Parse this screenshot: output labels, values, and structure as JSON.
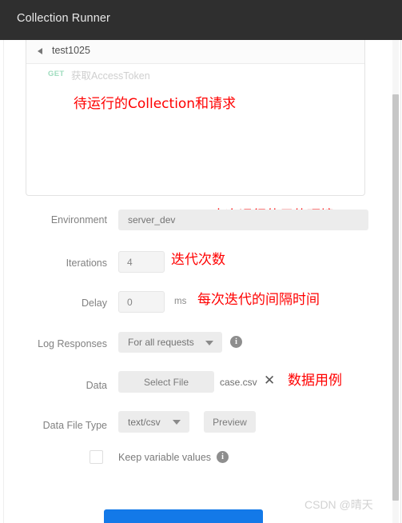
{
  "window": {
    "title": "Collection Runner"
  },
  "collection": {
    "name": "test1025",
    "collapse_icon": "caret-left-icon",
    "requests": [
      {
        "method": "GET",
        "name": "获取AccessToken"
      }
    ]
  },
  "annotations": [
    {
      "id": "collection",
      "text": "待运行的Collection和请求"
    },
    {
      "id": "environment",
      "text": "本次运行使用的环境"
    },
    {
      "id": "iterations",
      "text": "迭代次数"
    },
    {
      "id": "delay",
      "text": "每次迭代的间隔时间"
    },
    {
      "id": "data",
      "text": "数据用例"
    }
  ],
  "form": {
    "environment": {
      "label": "Environment",
      "value": "server_dev"
    },
    "iterations": {
      "label": "Iterations",
      "value": "4"
    },
    "delay": {
      "label": "Delay",
      "value": "0",
      "unit": "ms"
    },
    "log_responses": {
      "label": "Log Responses",
      "value": "For all requests",
      "caret_icon": "chevron-down-icon",
      "info_icon": "info-icon"
    },
    "data": {
      "label": "Data",
      "select_file_label": "Select File",
      "file_name": "case.csv",
      "clear_icon": "close-icon"
    },
    "data_file_type": {
      "label": "Data File Type",
      "value": "text/csv",
      "caret_icon": "chevron-down-icon",
      "preview_label": "Preview"
    },
    "keep_variable_values": {
      "label": "Keep variable values",
      "checked": false,
      "info_icon": "info-icon"
    }
  },
  "run_button": {
    "label": ""
  },
  "watermark": {
    "text": "CSDN @晴天"
  },
  "colors": {
    "titlebar": "#2f2f2f",
    "annotation_red": "#ff0000",
    "run_button_blue": "#1379e8",
    "method_get_green": "#9fdcbe",
    "field_gray": "#ececec"
  }
}
